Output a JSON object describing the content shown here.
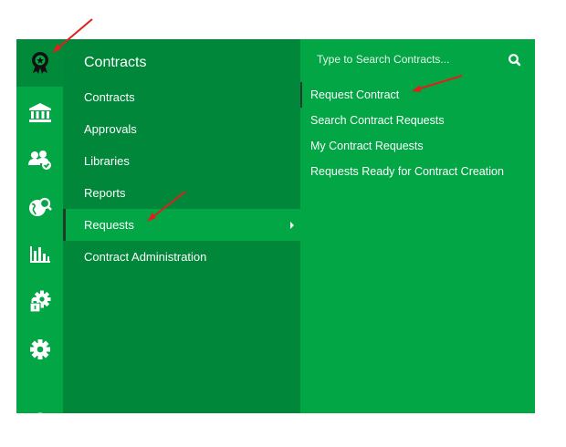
{
  "colors": {
    "rail_bg": "#02a644",
    "menu_bg": "#008739",
    "submenu_bg": "#02a644",
    "text": "#ffffff",
    "annotation_arrow": "#e0201b"
  },
  "rail": {
    "icons": [
      "award-ribbon-icon",
      "bank-icon",
      "users-check-icon",
      "globe-search-icon",
      "bar-chart-icon",
      "gear-lock-icon",
      "gear-icon",
      "search-icon"
    ]
  },
  "menu": {
    "title": "Contracts",
    "items": [
      {
        "label": "Contracts"
      },
      {
        "label": "Approvals"
      },
      {
        "label": "Libraries"
      },
      {
        "label": "Reports"
      },
      {
        "label": "Requests"
      },
      {
        "label": "Contract Administration"
      }
    ]
  },
  "submenu": {
    "search_placeholder": "Type to Search Contracts...",
    "items": [
      {
        "label": "Request Contract"
      },
      {
        "label": "Search Contract Requests"
      },
      {
        "label": "My Contract Requests"
      },
      {
        "label": "Requests Ready for Contract Creation"
      }
    ]
  }
}
